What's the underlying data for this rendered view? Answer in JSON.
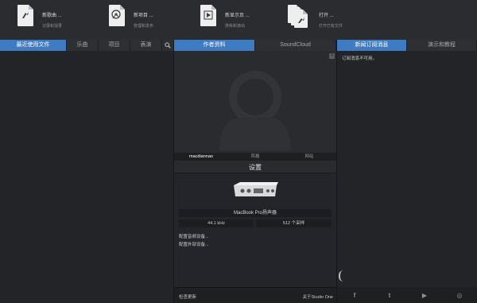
{
  "actions": [
    {
      "title": "新歌曲 ...",
      "subtitle": "记录和混录",
      "icon": "song-icon"
    },
    {
      "title": "新项目 ...",
      "subtitle": "管理和发布",
      "icon": "project-icon"
    },
    {
      "title": "新显示页 ...",
      "subtitle": "排练和演出",
      "icon": "show-icon"
    },
    {
      "title": "打开 ...",
      "subtitle": "打开已有文件",
      "icon": "open-files-icon"
    }
  ],
  "left_tabs": [
    "最近使用文件",
    "乐曲",
    "项目",
    "表演"
  ],
  "mid_tabs": [
    "作者资料",
    "SoundCloud"
  ],
  "profile": {
    "username": "macdiannao",
    "col2": "风格",
    "col3": "网站"
  },
  "settings": {
    "title": "设置",
    "device_name": "MacBook Pro扬声器",
    "sample_rate": "44.1 kHz",
    "buffer": "512 个采样",
    "link_audio": "配置音频设备...",
    "link_external": "配置外部设备..."
  },
  "footer": {
    "check_updates": "检查更新",
    "about": "关于Studio One"
  },
  "right_tabs": [
    "新闻订阅消息",
    "演示和教程"
  ],
  "news_message": "订阅消息不可用。",
  "social": [
    {
      "name": "facebook-icon",
      "glyph": "f"
    },
    {
      "name": "twitter-icon",
      "glyph": "t"
    },
    {
      "name": "youtube-icon",
      "glyph": "▶"
    },
    {
      "name": "instagram-icon",
      "glyph": "◎"
    }
  ],
  "colors": {
    "accent": "#3d7cc4",
    "background": "#2b2c2f",
    "panel": "#232427"
  }
}
